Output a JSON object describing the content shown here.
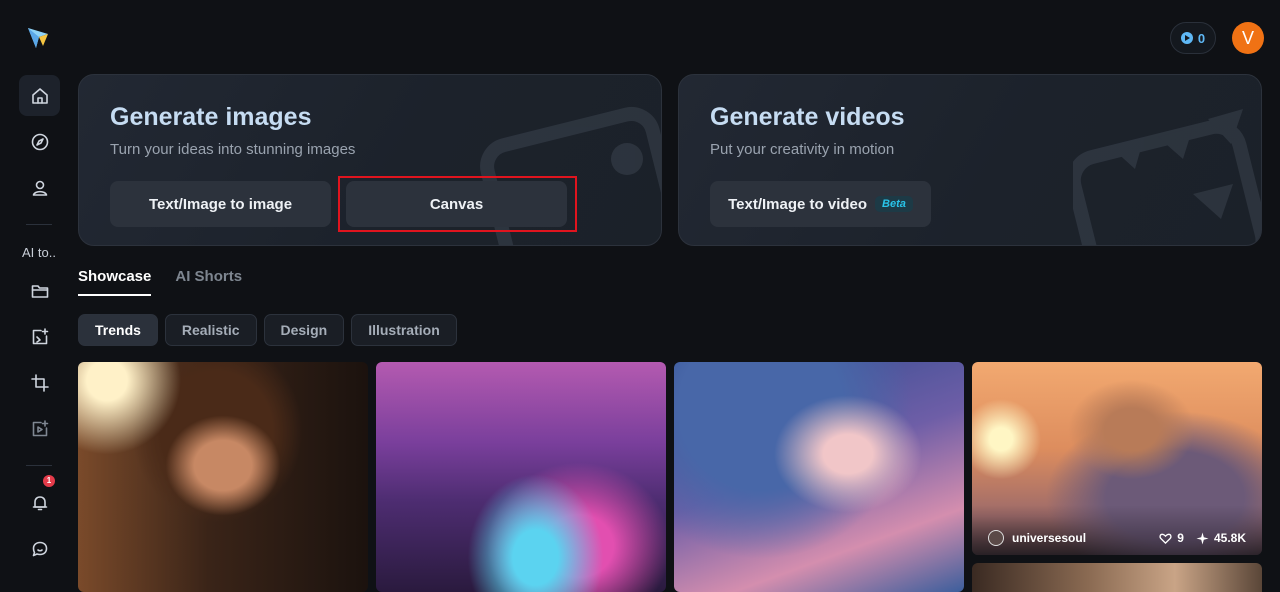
{
  "sidebar": {
    "ai_tools_label": "AI to..",
    "notification_count": "1"
  },
  "header": {
    "credits": "0",
    "avatar_initial": "V"
  },
  "hero_images": {
    "title": "Generate images",
    "subtitle": "Turn your ideas into stunning images",
    "buttons": [
      "Text/Image to image",
      "Canvas"
    ]
  },
  "hero_videos": {
    "title": "Generate videos",
    "subtitle": "Put your creativity in motion",
    "button": "Text/Image to video",
    "badge": "Beta"
  },
  "tabs": [
    "Showcase",
    "AI Shorts"
  ],
  "filters": [
    "Trends",
    "Realistic",
    "Design",
    "Illustration"
  ],
  "gallery": {
    "hovered_item": {
      "user": "universesoul",
      "likes": "9",
      "uses": "45.8K"
    }
  },
  "colors": {
    "accent": "#5fb8f5",
    "avatar": "#f07214",
    "highlight": "#e0141e",
    "beta": "#29c3e8"
  }
}
